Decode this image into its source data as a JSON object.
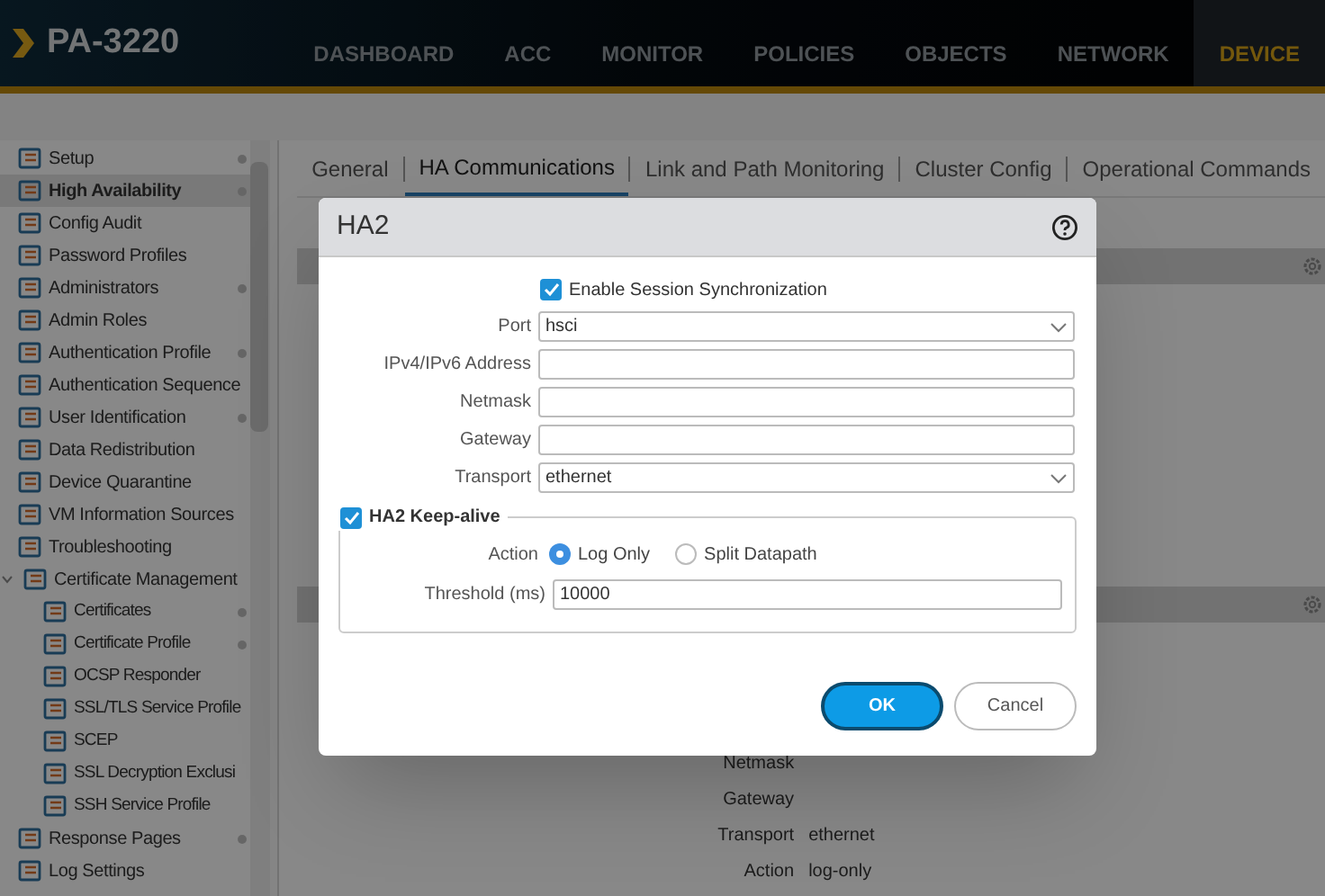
{
  "app": {
    "logo": "PA-3220"
  },
  "nav": [
    {
      "label": "DASHBOARD",
      "selected": false
    },
    {
      "label": "ACC",
      "selected": false
    },
    {
      "label": "MONITOR",
      "selected": false
    },
    {
      "label": "POLICIES",
      "selected": false
    },
    {
      "label": "OBJECTS",
      "selected": false
    },
    {
      "label": "NETWORK",
      "selected": false
    },
    {
      "label": "DEVICE",
      "selected": true
    }
  ],
  "sidebar": {
    "items": [
      {
        "label": "Setup",
        "selected": false,
        "marked": true
      },
      {
        "label": "High Availability",
        "selected": true,
        "marked": true
      },
      {
        "label": "Config Audit",
        "selected": false,
        "marked": false
      },
      {
        "label": "Password Profiles",
        "selected": false,
        "marked": false
      },
      {
        "label": "Administrators",
        "selected": false,
        "marked": true
      },
      {
        "label": "Admin Roles",
        "selected": false,
        "marked": false
      },
      {
        "label": "Authentication Profile",
        "selected": false,
        "marked": true
      },
      {
        "label": "Authentication Sequence",
        "selected": false,
        "marked": false
      },
      {
        "label": "User Identification",
        "selected": false,
        "marked": true
      },
      {
        "label": "Data Redistribution",
        "selected": false,
        "marked": false
      },
      {
        "label": "Device Quarantine",
        "selected": false,
        "marked": false
      },
      {
        "label": "VM Information Sources",
        "selected": false,
        "marked": false
      },
      {
        "label": "Troubleshooting",
        "selected": false,
        "marked": false
      },
      {
        "label": "Certificate Management",
        "selected": false,
        "marked": false,
        "expanded": true,
        "children": [
          {
            "label": "Certificates",
            "selected": false,
            "marked": true
          },
          {
            "label": "Certificate Profile",
            "selected": false,
            "marked": true
          },
          {
            "label": "OCSP Responder",
            "selected": false,
            "marked": false
          },
          {
            "label": "SSL/TLS Service Profile",
            "selected": false,
            "marked": false
          },
          {
            "label": "SCEP",
            "selected": false,
            "marked": false
          },
          {
            "label": "SSL Decryption Exclusi",
            "selected": false,
            "marked": false
          },
          {
            "label": "SSH Service Profile",
            "selected": false,
            "marked": false
          }
        ]
      },
      {
        "label": "Response Pages",
        "selected": false,
        "marked": true
      },
      {
        "label": "Log Settings",
        "selected": false,
        "marked": false
      }
    ]
  },
  "tabs": [
    {
      "label": "General",
      "selected": false
    },
    {
      "label": "HA Communications",
      "selected": true
    },
    {
      "label": "Link and Path Monitoring",
      "selected": false
    },
    {
      "label": "Cluster Config",
      "selected": false
    },
    {
      "label": "Operational Commands",
      "selected": false
    }
  ],
  "background_fields": [
    {
      "label": "Netmask"
    },
    {
      "label": "Gateway"
    },
    {
      "label": "Transport",
      "value": "ethernet"
    },
    {
      "label": "Action",
      "value": "log-only"
    }
  ],
  "dialog": {
    "title": "HA2",
    "session_sync": {
      "label": "Enable Session Synchronization",
      "checked": true
    },
    "fields": [
      {
        "label": "Port",
        "kind": "select",
        "value": "hsci"
      },
      {
        "label": "IPv4/IPv6 Address",
        "kind": "text"
      },
      {
        "label": "Netmask",
        "kind": "text"
      },
      {
        "label": "Gateway",
        "kind": "text"
      },
      {
        "label": "Transport",
        "kind": "select",
        "value": "ethernet"
      }
    ],
    "keepalive": {
      "label": "HA2 Keep-alive",
      "checked": true,
      "action": {
        "label": "Action",
        "options": [
          {
            "label": "Log Only",
            "selected": true
          },
          {
            "label": "Split Datapath",
            "selected": false
          }
        ]
      },
      "threshold": {
        "label": "Threshold (ms)",
        "value": "10000"
      }
    },
    "buttons": [
      {
        "label": "OK",
        "kind": "primary"
      },
      {
        "label": "Cancel",
        "kind": "secondary"
      }
    ]
  }
}
